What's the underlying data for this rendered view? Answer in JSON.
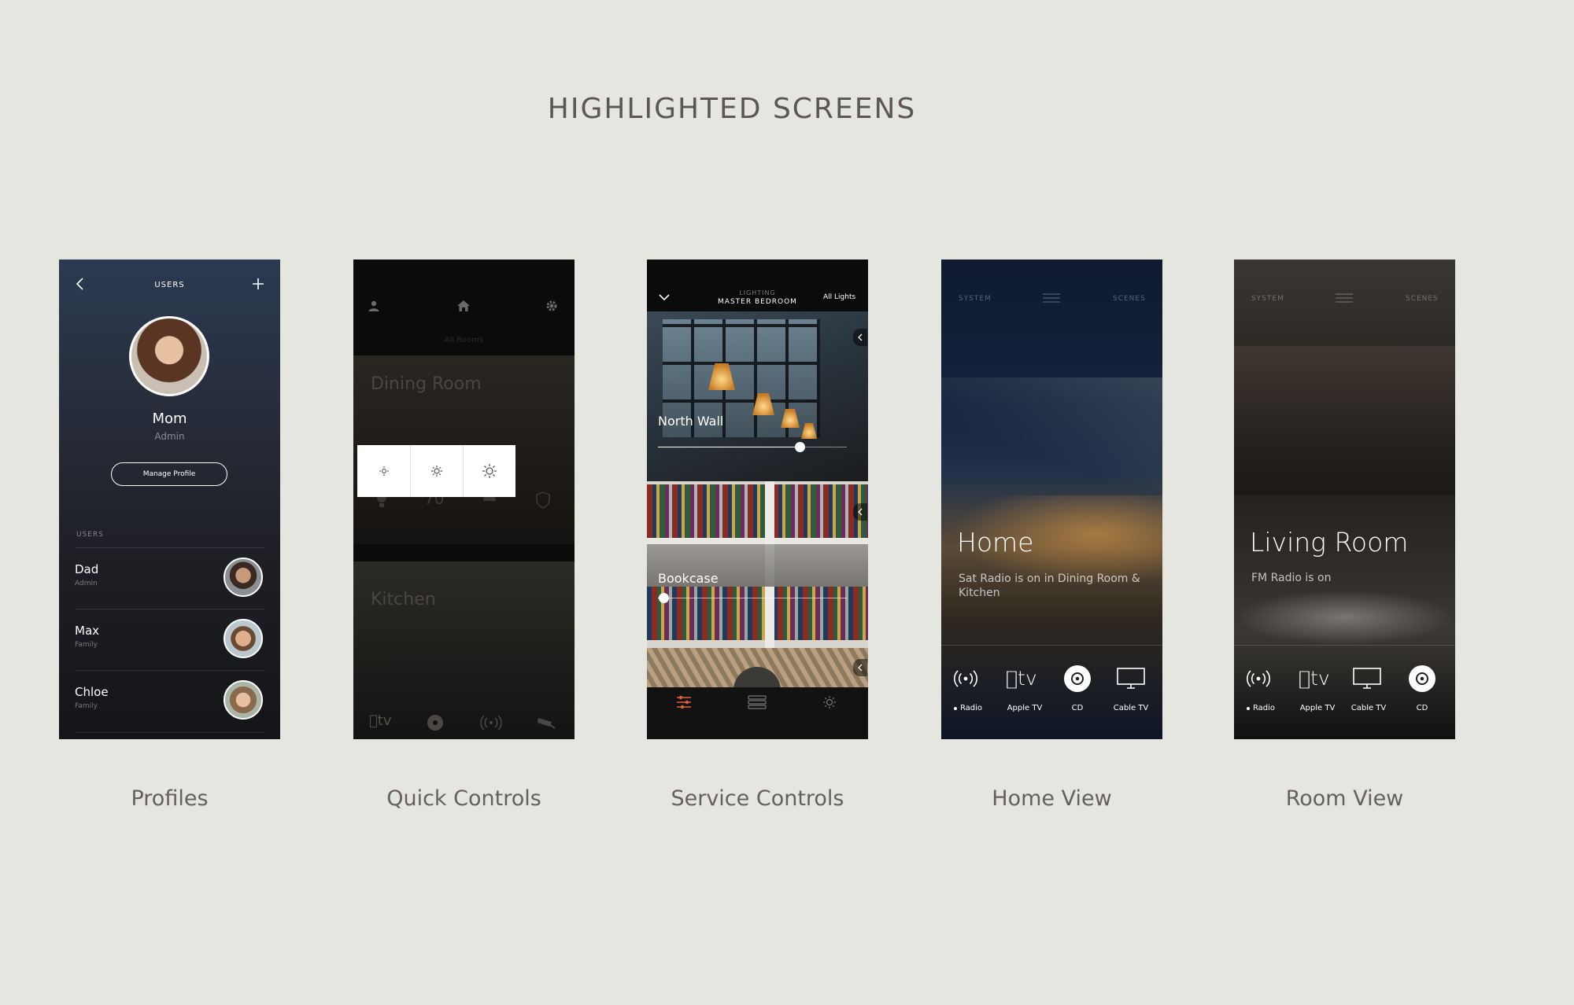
{
  "heading": "HIGHLIGHTED SCREENS",
  "captions": [
    "Profiles",
    "Quick Controls",
    "Service Controls",
    "Home View",
    "Room View"
  ],
  "profiles": {
    "header_title": "USERS",
    "main_user_name": "Mom",
    "main_user_role": "Admin",
    "manage_button": "Manage Profile",
    "section_label": "USERS",
    "users": [
      {
        "name": "Dad",
        "role": "Admin"
      },
      {
        "name": "Max",
        "role": "Family"
      },
      {
        "name": "Chloe",
        "role": "Family"
      }
    ]
  },
  "quick_controls": {
    "subtitle": "All Rooms",
    "rooms": [
      "Dining Room",
      "Kitchen"
    ],
    "temperature": "70°"
  },
  "service_controls": {
    "header_small": "LIGHTING",
    "header_title": "MASTER BEDROOM",
    "all_lights": "All Lights",
    "lights": [
      {
        "name": "North Wall",
        "level": 0.75
      },
      {
        "name": "Bookcase",
        "level": 0.03
      }
    ]
  },
  "home_view": {
    "nav_left": "SYSTEM",
    "nav_right": "SCENES",
    "title": "Home",
    "status": "Sat Radio is on in Dining Room & Kitchen",
    "sources": [
      "Radio",
      "Apple TV",
      "CD",
      "Cable TV"
    ],
    "apple_tv_text": "tv"
  },
  "room_view": {
    "nav_left": "SYSTEM",
    "nav_right": "SCENES",
    "title": "Living Room",
    "status": "FM Radio is on",
    "sources": [
      "Radio",
      "Apple TV",
      "Cable TV",
      "CD"
    ],
    "apple_tv_text": "tv"
  },
  "colors": {
    "page_bg": "#e6e6e1",
    "heading": "#5d5752",
    "accent_orange": "#e0603a"
  }
}
